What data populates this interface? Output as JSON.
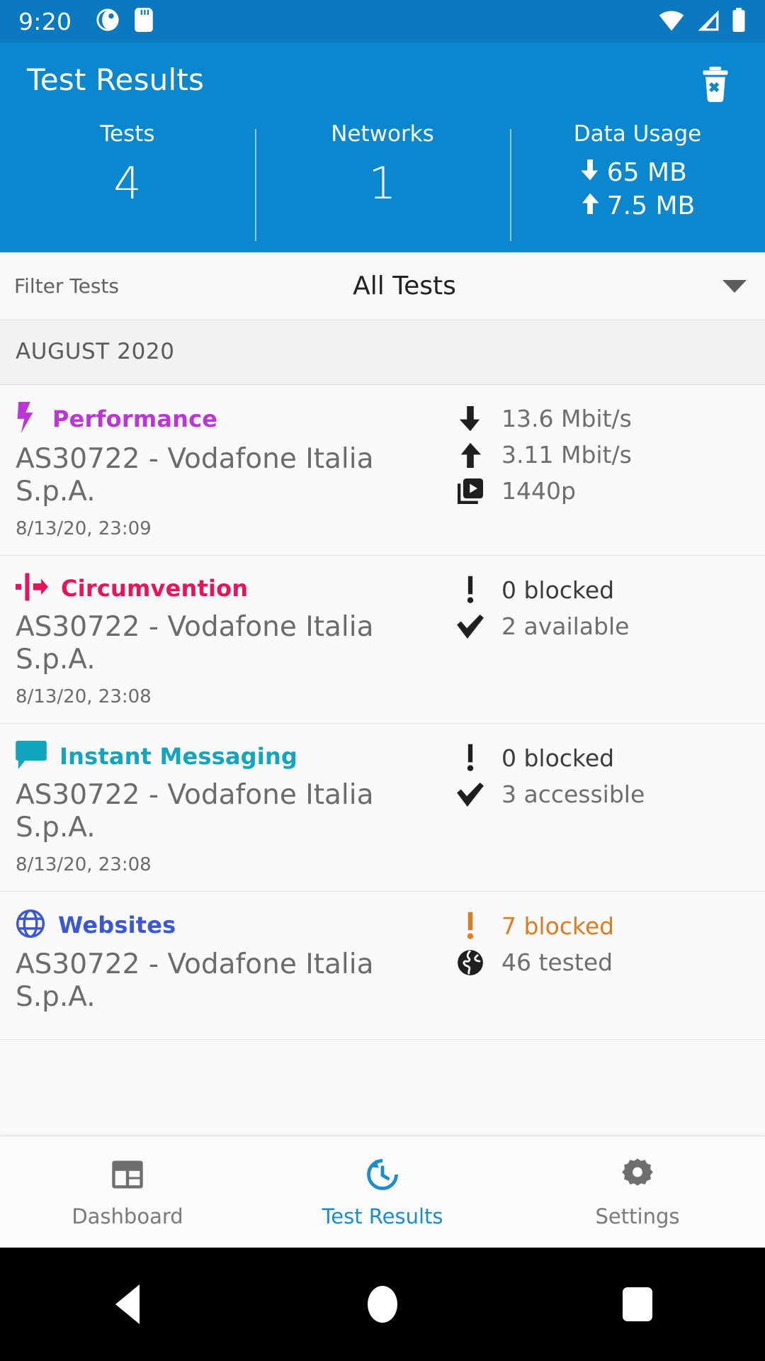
{
  "status_bar": {
    "time": "9:20",
    "left_icons": [
      "ooni-app-icon",
      "sd-card-icon"
    ],
    "right_icons": [
      "wifi-icon",
      "cellular-signal-icon",
      "battery-icon"
    ]
  },
  "header": {
    "title": "Test Results",
    "delete_icon": "delete-all-icon",
    "background_color": "#0b87cf",
    "stats": [
      {
        "label": "Tests",
        "value": "4"
      },
      {
        "label": "Networks",
        "value": "1"
      }
    ],
    "data_usage": {
      "label": "Data Usage",
      "download": "65 MB",
      "upload": "7.5 MB"
    }
  },
  "filter": {
    "label": "Filter Tests",
    "value": "All Tests",
    "caret_icon": "chevron-down-icon"
  },
  "list": {
    "month_header": "AUGUST 2020",
    "cards": [
      {
        "title": "Performance",
        "color": "#bb35d8",
        "icon": "lightning-bolt-icon",
        "network": "AS30722 - Vodafone Italia S.p.A.",
        "timestamp": "8/13/20, 23:09",
        "measurements": [
          {
            "icon": "download-arrow-icon",
            "text": "13.6 Mbit/s",
            "style": "normal"
          },
          {
            "icon": "upload-arrow-icon",
            "text": "3.11 Mbit/s",
            "style": "normal"
          },
          {
            "icon": "video-quality-icon",
            "text": "1440p",
            "style": "normal"
          }
        ]
      },
      {
        "title": "Circumvention",
        "color": "#e8145b",
        "icon": "circumvention-icon",
        "network": "AS30722 - Vodafone Italia S.p.A.",
        "timestamp": "8/13/20, 23:08",
        "measurements": [
          {
            "icon": "exclamation-icon",
            "text": "0 blocked",
            "style": "dark"
          },
          {
            "icon": "checkmark-icon",
            "text": "2 available",
            "style": "normal"
          }
        ]
      },
      {
        "title": "Instant Messaging",
        "color": "#12a5bd",
        "icon": "chat-bubble-icon",
        "network": "AS30722 - Vodafone Italia S.p.A.",
        "timestamp": "8/13/20, 23:08",
        "measurements": [
          {
            "icon": "exclamation-icon",
            "text": "0 blocked",
            "style": "dark"
          },
          {
            "icon": "checkmark-icon",
            "text": "3 accessible",
            "style": "normal"
          }
        ]
      },
      {
        "title": "Websites",
        "color": "#3b57d8",
        "icon": "globe-outline-icon",
        "network": "AS30722 - Vodafone Italia S.p.A.",
        "timestamp": "",
        "measurements": [
          {
            "icon": "exclamation-icon",
            "text": "7 blocked",
            "style": "warn"
          },
          {
            "icon": "globe-filled-icon",
            "text": "46 tested",
            "style": "normal"
          }
        ]
      }
    ]
  },
  "bottom_nav": {
    "active_color": "#1a8cd0",
    "items": [
      {
        "label": "Dashboard",
        "icon": "dashboard-icon",
        "active": false
      },
      {
        "label": "Test Results",
        "icon": "history-clock-icon",
        "active": true
      },
      {
        "label": "Settings",
        "icon": "gear-icon",
        "active": false
      }
    ]
  },
  "android_nav": {
    "back": "back-triangle-icon",
    "home": "home-circle-icon",
    "recents": "recents-square-icon"
  }
}
